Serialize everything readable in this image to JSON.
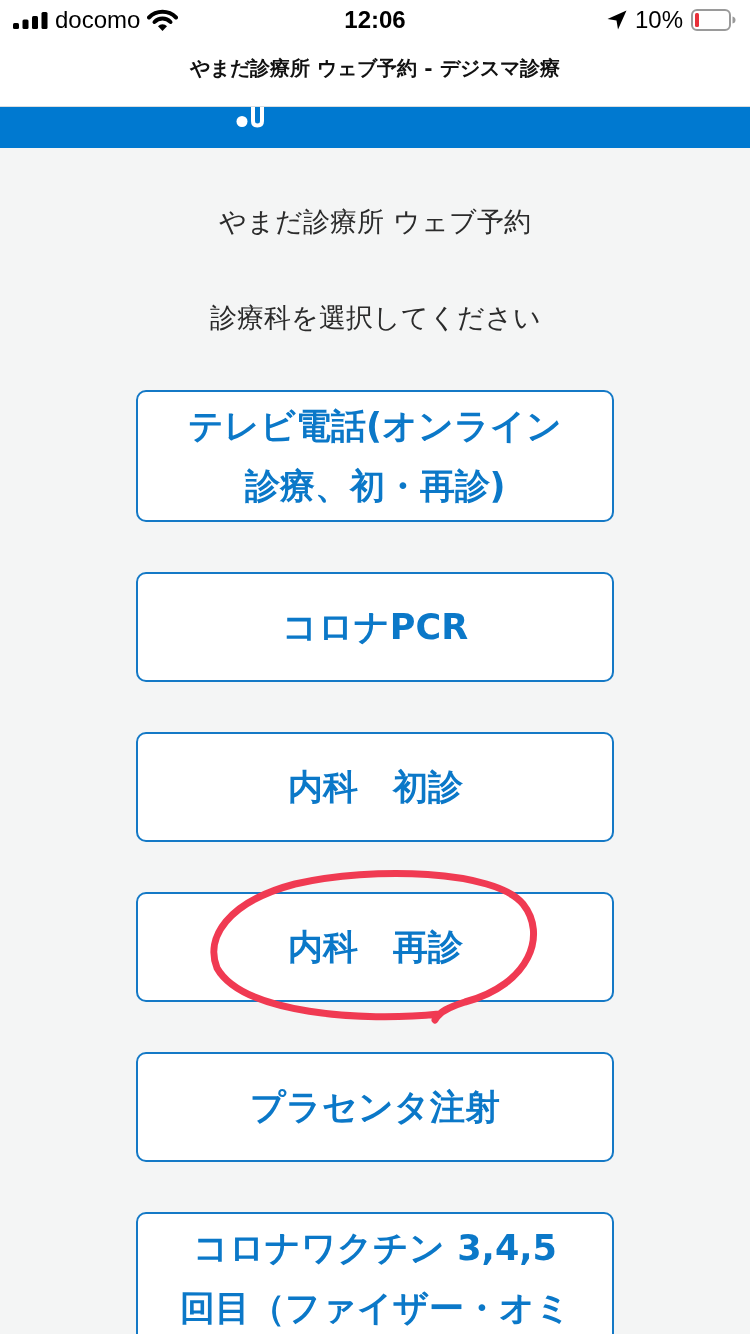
{
  "status_bar": {
    "carrier": "docomo",
    "time": "12:06",
    "battery": "10%"
  },
  "page_title": "やまだ診療所 ウェブ予約 - デジスマ診療",
  "clinic_name": "やまだ診療所 ウェブ予約",
  "instruction": "診療科を選択してください",
  "departments": [
    {
      "label": "テレビ電話(オンライン診療、初・再診)",
      "circled": false
    },
    {
      "label": "コロナPCR",
      "circled": false
    },
    {
      "label": "内科　初診",
      "circled": false
    },
    {
      "label": "内科　再診",
      "circled": true
    },
    {
      "label": "プラセンタ注射",
      "circled": false
    },
    {
      "label": "コロナワクチン 3,4,5回目（ファイザー・オミ",
      "circled": false
    }
  ]
}
